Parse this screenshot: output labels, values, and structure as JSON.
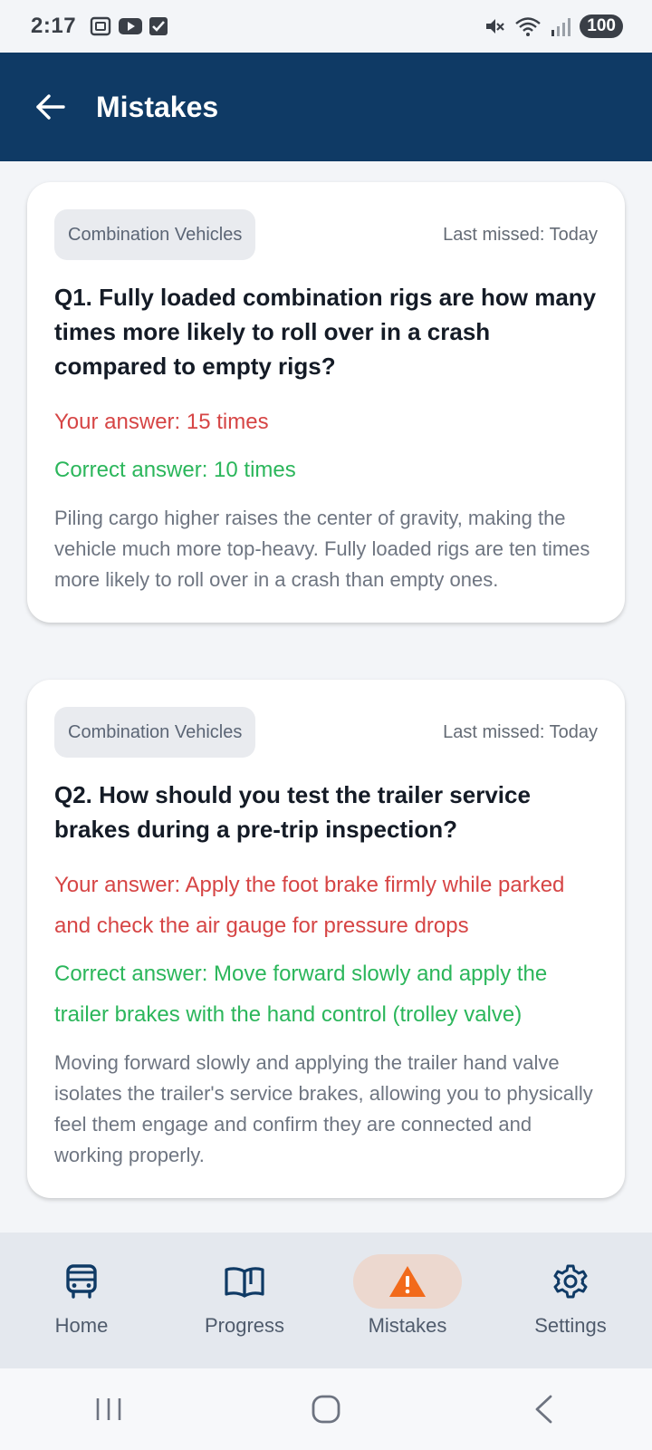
{
  "status_bar": {
    "time": "2:17",
    "battery": "100"
  },
  "app_bar": {
    "title": "Mistakes"
  },
  "mistakes": [
    {
      "category": "Combination Vehicles",
      "last_missed": "Last missed: Today",
      "question": "Q1. Fully loaded combination rigs are how many times more likely to roll over in a crash compared to empty rigs?",
      "your_answer": "Your answer: 15 times",
      "correct_answer": "Correct answer: 10 times",
      "explanation": "Piling cargo higher raises the center of gravity, making the vehicle much more top-heavy. Fully loaded rigs are ten times more likely to roll over in a crash than empty ones."
    },
    {
      "category": "Combination Vehicles",
      "last_missed": "Last missed: Today",
      "question": "Q2. How should you test the trailer service brakes during a pre-trip inspection?",
      "your_answer": "Your answer: Apply the foot brake firmly while parked and check the air gauge for pressure drops",
      "correct_answer": "Correct answer: Move forward slowly and apply the trailer brakes with the hand control (trolley valve)",
      "explanation": "Moving forward slowly and applying the trailer hand valve isolates the trailer's service brakes, allowing you to physically feel them engage and confirm they are connected and working properly."
    }
  ],
  "bottom_nav": [
    {
      "label": "Home",
      "icon": "bus-icon"
    },
    {
      "label": "Progress",
      "icon": "open-book-icon"
    },
    {
      "label": "Mistakes",
      "icon": "warning-icon",
      "active": true
    },
    {
      "label": "Settings",
      "icon": "gear-icon"
    }
  ],
  "colors": {
    "app_bar": "#0f3a65",
    "wrong": "#d64545",
    "correct": "#2bb65b",
    "warning_icon": "#f26a1b",
    "nav_icon": "#0f3a65"
  }
}
